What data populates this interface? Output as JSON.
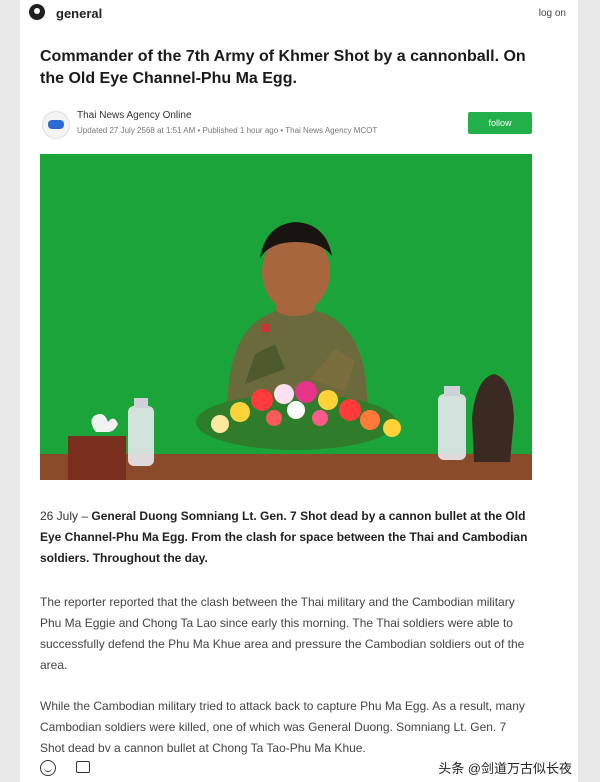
{
  "topbar": {
    "site_name": "general",
    "login_label": "log on"
  },
  "article": {
    "headline": "Commander of the 7th Army of Khmer Shot by a cannonball. On the Old Eye Channel-Phu Ma Egg.",
    "author": "Thai News Agency Online",
    "meta": "Updated 27 July 2568 at 1:51 AM • Published 1 hour ago • Thai News Agency MCOT",
    "follow_label": "follow",
    "lead_date": "26 July – ",
    "lead_bold": "General Duong Somniang Lt. Gen. 7 Shot dead by a cannon bullet at the Old Eye Channel-Phu Ma Egg. From the clash for space between the Thai and Cambodian soldiers. Throughout the day.",
    "para2": "The reporter reported that the clash between the Thai military and the Cambodian military Phu Ma Eggie and Chong Ta Lao since early this morning. The Thai soldiers were able to successfully defend the Phu Ma Khue area and pressure the Cambodian soldiers out of the area.",
    "para3": "While the Cambodian military tried to attack back to capture Phu Ma Egg. As a result, many Cambodian soldiers were killed, one of which was General Duong. Somniang Lt. Gen. 7 Shot dead bv a cannon bullet at Chong Ta Tao-Phu Ma Khue."
  },
  "bottombar": {
    "icons": [
      "smile-icon",
      "comment-icon"
    ],
    "watermark": "头条 @剑道万古似长夜"
  },
  "colors": {
    "follow_button": "#22b04b",
    "photo_background": "#1aa43a"
  }
}
